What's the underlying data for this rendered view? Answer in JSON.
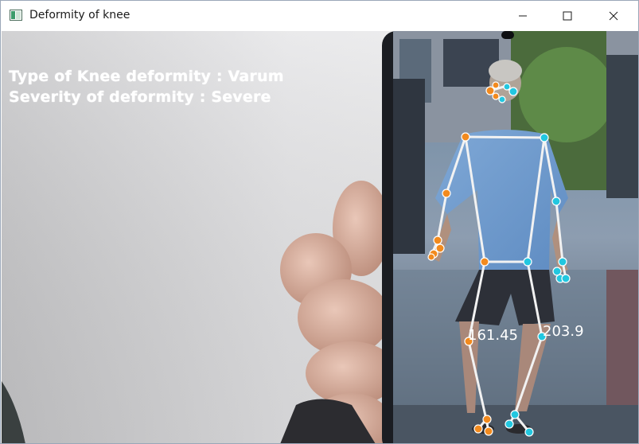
{
  "window": {
    "title": "Deformity of knee",
    "icon": "opencv-window-icon",
    "controls": [
      "minimize-icon",
      "maximize-icon",
      "close-icon"
    ]
  },
  "overlay": {
    "line1": "Type of Knee deformity : Varum",
    "line2": "Severity of deformity : Severe",
    "left_knee_angle": "161.45",
    "right_knee_angle": "203.9"
  },
  "colors": {
    "left_joint": "#f28a1e",
    "right_joint": "#22c7e0",
    "skeleton_line": "#f2f2f2",
    "overlay_text": "#ffffff"
  }
}
